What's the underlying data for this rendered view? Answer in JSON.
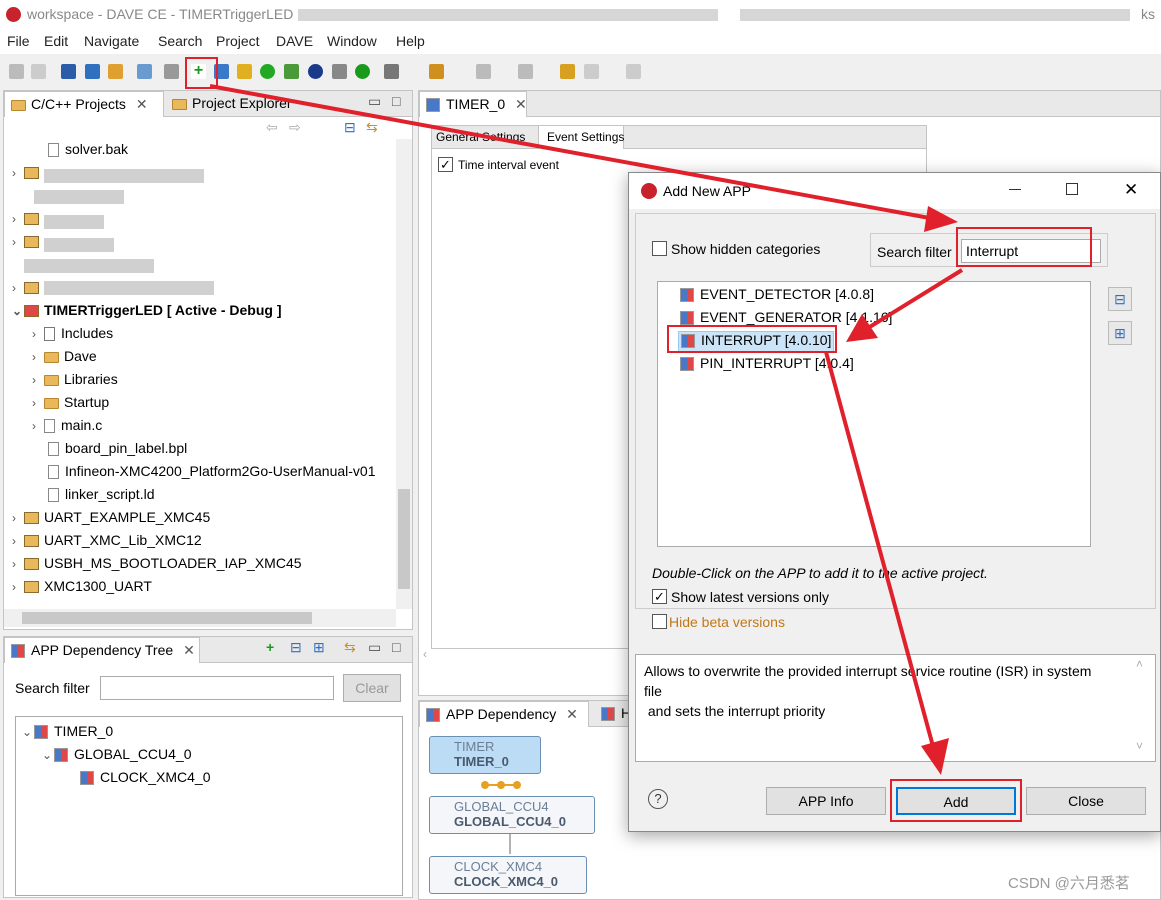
{
  "window": {
    "title": "workspace - DAVE CE - TIMERTriggerLED",
    "title_suffix": "ks"
  },
  "menu": [
    "File",
    "Edit",
    "Navigate",
    "Search",
    "Project",
    "DAVE",
    "Window",
    "Help"
  ],
  "projects_panel": {
    "tab_cpp": "C/C++ Projects",
    "tab_explorer": "Project Explorer",
    "items": {
      "solver": "solver.bak",
      "active_project": "TIMERTriggerLED [ Active - Debug ]",
      "includes": "Includes",
      "dave": "Dave",
      "libraries": "Libraries",
      "startup": "Startup",
      "mainc": "main.c",
      "bpl": "board_pin_label.bpl",
      "manual": "Infineon-XMC4200_Platform2Go-UserManual-v01",
      "linker": "linker_script.ld",
      "uart45": "UART_EXAMPLE_XMC45",
      "uart12": "UART_XMC_Lib_XMC12",
      "usbh": "USBH_MS_BOOTLOADER_IAP_XMC45",
      "xmc1300": "XMC1300_UART"
    }
  },
  "dep_tree_panel": {
    "tab": "APP Dependency Tree",
    "search_label": "Search filter",
    "search_value": "",
    "clear": "Clear",
    "nodes": {
      "timer": "TIMER_0",
      "ccu": "GLOBAL_CCU4_0",
      "clock": "CLOCK_XMC4_0"
    }
  },
  "editor": {
    "tab": "TIMER_0",
    "subtab_general": "General Settings",
    "subtab_event": "Event Settings",
    "checkbox_label": "Time interval event",
    "checkbox_checked": true
  },
  "dep_graph": {
    "tab": "APP Dependency",
    "tab2": "H",
    "nodes": {
      "timer_type": "TIMER",
      "timer_name": "TIMER_0",
      "ccu_type": "GLOBAL_CCU4",
      "ccu_name": "GLOBAL_CCU4_0",
      "clock_type": "CLOCK_XMC4",
      "clock_name": "CLOCK_XMC4_0"
    }
  },
  "dialog": {
    "title": "Add New APP",
    "show_hidden": "Show hidden categories",
    "show_hidden_checked": false,
    "search_label": "Search filter",
    "search_value": "Interrupt",
    "apps": {
      "event_detector": "EVENT_DETECTOR [4.0.8]",
      "event_generator": "EVENT_GENERATOR [4.1.16]",
      "interrupt": "INTERRUPT [4.0.10]",
      "pin_interrupt": "PIN_INTERRUPT [4.0.4]"
    },
    "hint": "Double-Click on the APP to add it to the active project.",
    "latest_label": "Show latest versions only",
    "latest_checked": true,
    "beta_label": "Hide beta versions",
    "beta_checked": false,
    "description_line1": "Allows to overwrite the provided interrupt service routine (ISR) in system",
    "description_line2": "file",
    "description_line3": " and sets the interrupt priority",
    "buttons": {
      "info": "APP Info",
      "add": "Add",
      "close": "Close"
    }
  },
  "watermark": "CSDN @六月悉茗",
  "colors": {
    "highlight": "#cce4f7",
    "annotation_red": "#e0202a",
    "add_button_border": "#0078d7"
  }
}
